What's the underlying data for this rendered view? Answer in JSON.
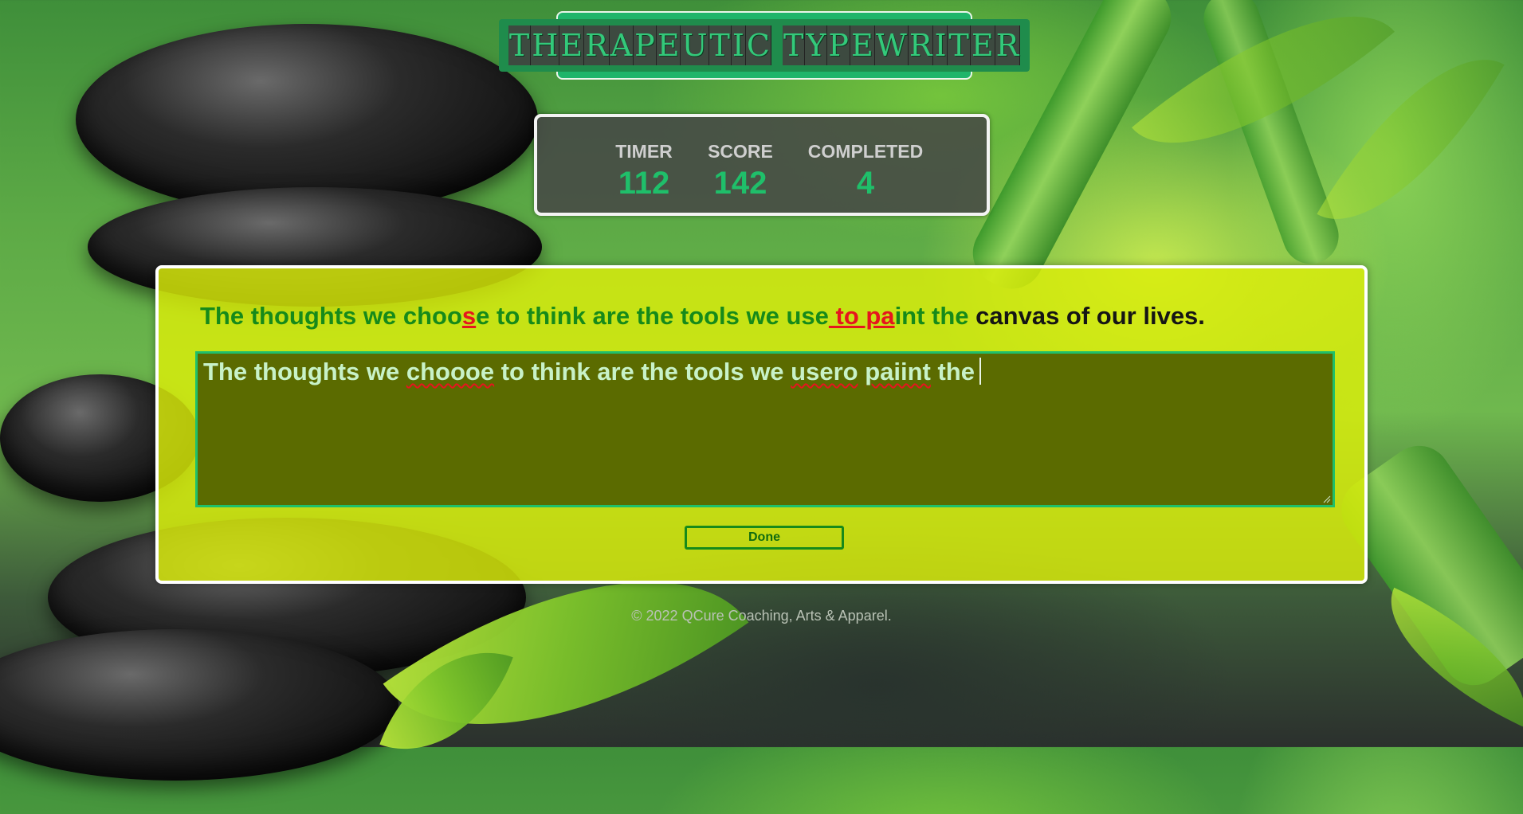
{
  "app": {
    "logo_text": "THERAPEUTIC TYPEWRITER"
  },
  "stats": {
    "timer_label": "TIMER",
    "timer_value": "112",
    "score_label": "SCORE",
    "score_value": "142",
    "completed_label": "COMPLETED",
    "completed_value": "4"
  },
  "prompt": {
    "segments": [
      {
        "text": "The thoughts we choo",
        "state": "correct"
      },
      {
        "text": "s",
        "state": "error"
      },
      {
        "text": "e to think are the tools we use",
        "state": "correct"
      },
      {
        "text": " to pa",
        "state": "error"
      },
      {
        "text": "int the",
        "state": "correct"
      },
      {
        "text": " canvas of our lives.",
        "state": "pending"
      }
    ]
  },
  "typing": {
    "words": [
      {
        "text": "The thoughts we ",
        "misspelled": false
      },
      {
        "text": "choooe",
        "misspelled": true
      },
      {
        "text": " to think are the tools we ",
        "misspelled": false
      },
      {
        "text": "usero",
        "misspelled": true
      },
      {
        "text": " ",
        "misspelled": false
      },
      {
        "text": "paiint",
        "misspelled": true
      },
      {
        "text": " the",
        "misspelled": false
      }
    ]
  },
  "actions": {
    "done_label": "Done"
  },
  "footer": {
    "copyright": "© 2022 QCure Coaching, Arts & Apparel."
  },
  "colors": {
    "accent_green": "#1fbf6a",
    "correct_text": "#168a1a",
    "error_text": "#e6151e",
    "panel_yellow": "#dcee0a",
    "input_bg": "#5b6b00"
  }
}
